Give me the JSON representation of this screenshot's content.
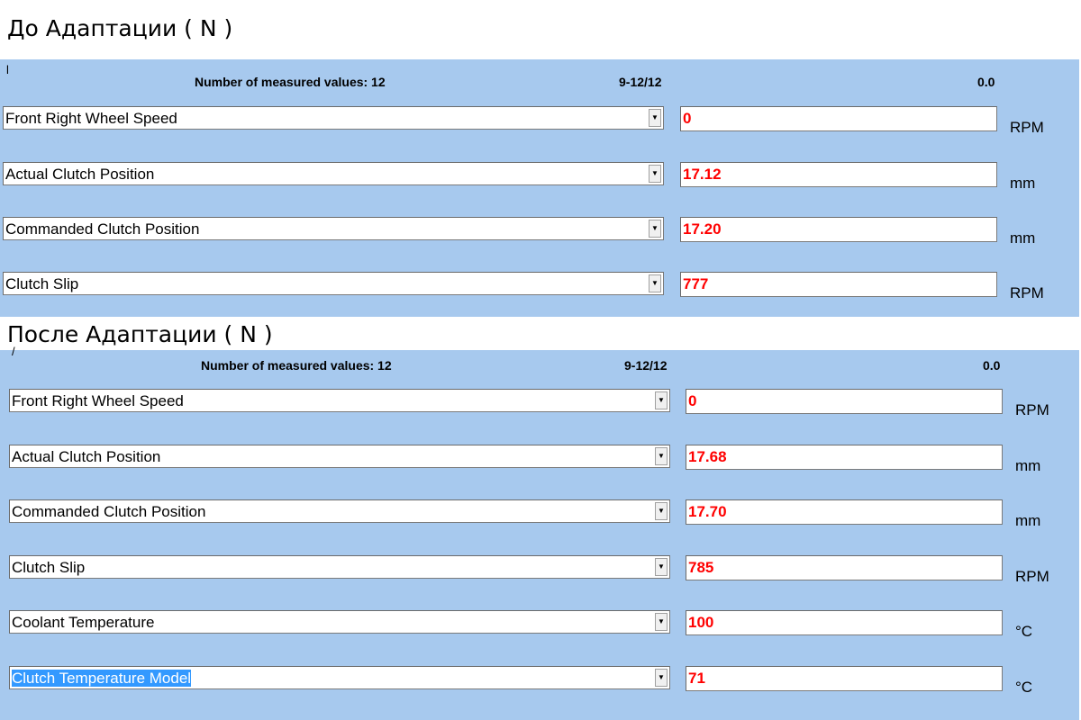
{
  "before": {
    "heading": "До Адаптации ( N )",
    "marker": "l",
    "header": {
      "count": "Number of measured values: 12",
      "range": "9-12/12",
      "value": "0.0"
    },
    "rows": [
      {
        "label": "Front Right Wheel Speed",
        "value": "0",
        "unit": "RPM"
      },
      {
        "label": "Actual Clutch Position",
        "value": "17.12",
        "unit": "mm"
      },
      {
        "label": "Commanded Clutch Position",
        "value": "17.20",
        "unit": "mm"
      },
      {
        "label": "Clutch Slip",
        "value": "777",
        "unit": "RPM"
      }
    ]
  },
  "after": {
    "heading": "После Адаптации ( N )",
    "marker": "/",
    "header": {
      "count": "Number of measured values: 12",
      "range": "9-12/12",
      "value": "0.0"
    },
    "rows": [
      {
        "label": "Front Right Wheel Speed",
        "value": "0",
        "unit": "RPM"
      },
      {
        "label": "Actual Clutch Position",
        "value": "17.68",
        "unit": "mm"
      },
      {
        "label": "Commanded Clutch Position",
        "value": "17.70",
        "unit": "mm"
      },
      {
        "label": "Clutch Slip",
        "value": "785",
        "unit": "RPM"
      },
      {
        "label": "Coolant Temperature",
        "value": "100",
        "unit": "°C"
      },
      {
        "label": "Clutch Temperature Model",
        "value": "71",
        "unit": "°C",
        "selected": true
      }
    ]
  },
  "colors": {
    "panel": "#a7c9ee",
    "value_text": "#ff0000",
    "selection": "#3399ff"
  },
  "icons": {
    "dropdown": "chevron-down-icon"
  }
}
